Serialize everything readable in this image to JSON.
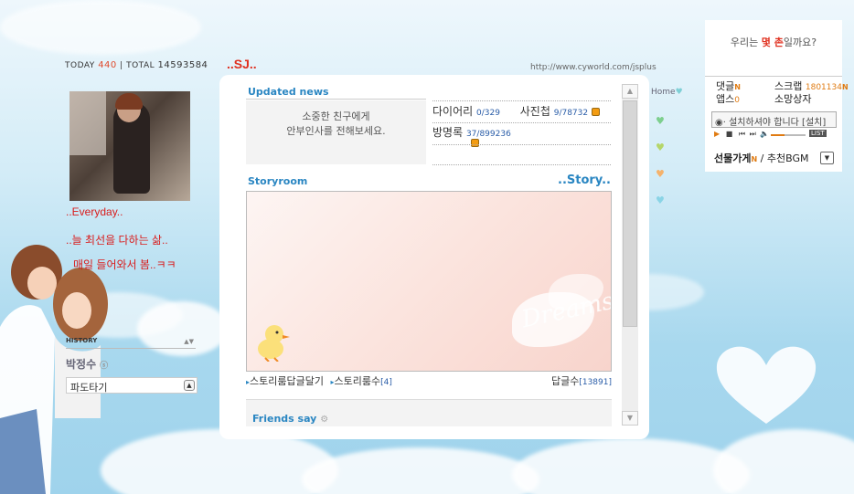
{
  "counter": {
    "today_label": "TODAY",
    "today_value": "440",
    "sep": "|",
    "total_label": "TOTAL",
    "total_value": "14593584"
  },
  "profile": {
    "line1": "..Everyday..",
    "line2": "..늘 최선을 다하는 삶..",
    "line3": "매일 들어와서 봄..ㅋㅋ"
  },
  "history": {
    "label": "HISTORY",
    "arrows": "▲▼"
  },
  "owner": {
    "name": "박정수",
    "icon": "ⓢ"
  },
  "select": {
    "value": "파도타기"
  },
  "header": {
    "title": "..SJ..",
    "url": "http://www.cyworld.com/jsplus"
  },
  "updated": {
    "title": "Updated news",
    "message_line1": "소중한 친구에게",
    "message_line2": "안부인사를 전해보세요."
  },
  "stats": {
    "diary_label": "다이어리",
    "diary_count": "0/329",
    "photo_label": "사진첩",
    "photo_count": "9/78732",
    "guest_label": "방명록",
    "guest_count": "37/899236"
  },
  "story": {
    "title": "Storyroom",
    "link": "..Story..",
    "footer_reply": "스토리룸답글달기",
    "footer_count_label": "스토리룸수",
    "footer_count": "[4]",
    "footer_comments_label": "답글수",
    "footer_comments": "[13891]"
  },
  "friends": {
    "title": "Friends say"
  },
  "nav": {
    "home": "Home"
  },
  "right": {
    "question_pre": "우리는 ",
    "question_hl": "몇 촌",
    "question_post": "일까요?",
    "comment_label": "댓글",
    "scrap_label": "스크랩",
    "scrap_count": "1801134",
    "apps_label": "앱스",
    "apps_count": "0",
    "wish_label": "소망상자",
    "new_badge": "N",
    "player_text": "설치하셔야 합니다 [설치]",
    "list_label": "LIST",
    "gift_label": "선물가게",
    "gift_sep": " / 추천BGM"
  },
  "colors": {
    "accent_blue": "#2a86c2",
    "accent_red": "#e0301f",
    "accent_orange": "#e07b12"
  }
}
